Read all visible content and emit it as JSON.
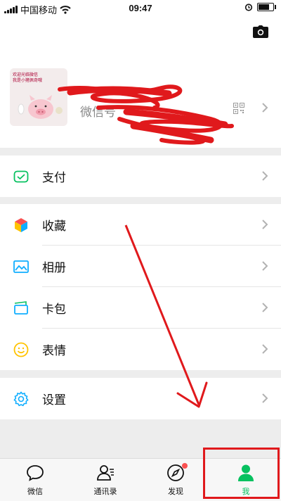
{
  "status_bar": {
    "carrier": "中国移动",
    "time": "09:47",
    "battery_level": 0.85
  },
  "profile": {
    "wechat_id_label": "微信号",
    "avatar_text_line1": "欢迎光临微信",
    "avatar_text_line2": "我是小猪佩奇哦"
  },
  "menu": {
    "pay": "支付",
    "favorites": "收藏",
    "album": "相册",
    "cards": "卡包",
    "stickers": "表情",
    "settings": "设置"
  },
  "tabs": [
    {
      "label": "微信",
      "icon": "chat-bubble-icon"
    },
    {
      "label": "通讯录",
      "icon": "contacts-icon"
    },
    {
      "label": "发现",
      "icon": "compass-icon",
      "badge": true
    },
    {
      "label": "我",
      "icon": "person-icon",
      "active": true
    }
  ],
  "colors": {
    "accent": "#07c160",
    "annotation": "#e0191c",
    "badge": "#fa5151"
  }
}
